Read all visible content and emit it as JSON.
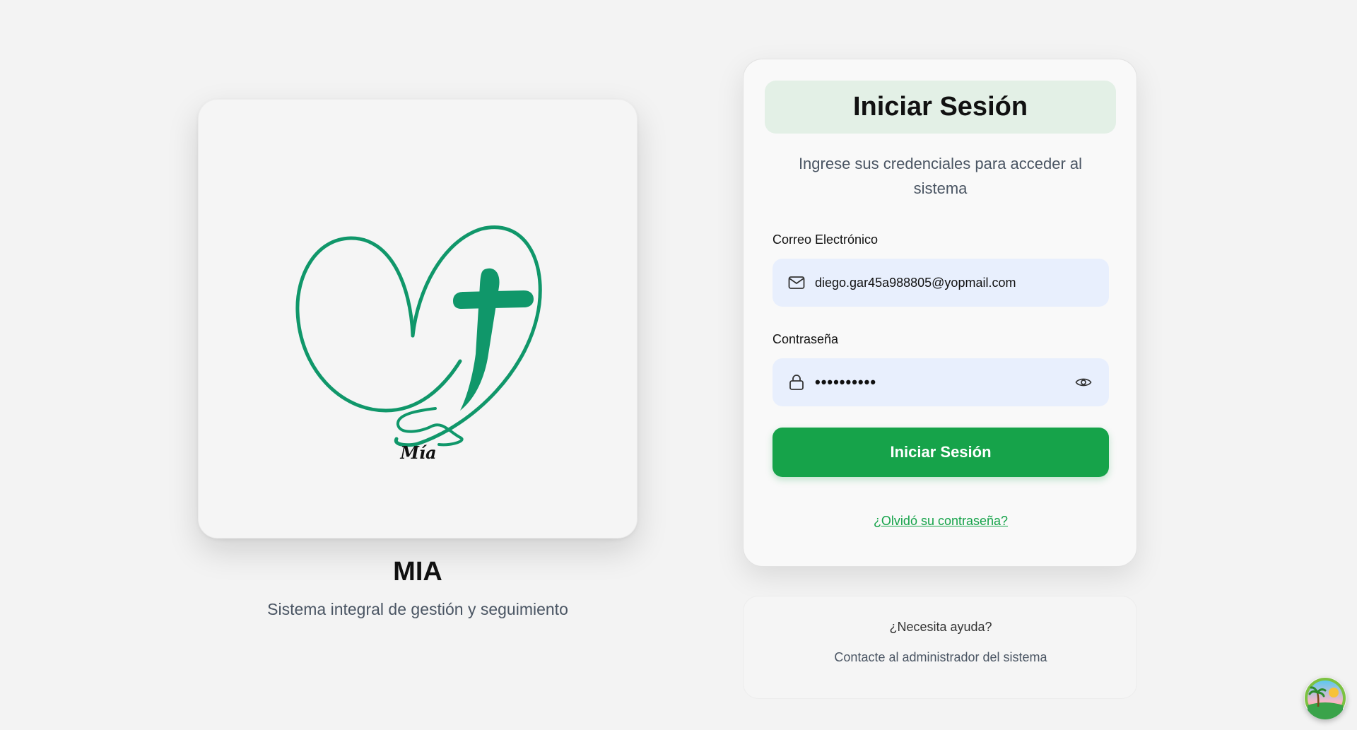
{
  "brand": {
    "logo_caption": "Mía",
    "title": "MIA",
    "subtitle": "Sistema integral de gestión y seguimiento",
    "accent_color": "#10976a"
  },
  "login": {
    "heading": "Iniciar Sesión",
    "description": "Ingrese sus credenciales para acceder al sistema",
    "email_label": "Correo Electrónico",
    "email_value": "diego.gar45a988805@yopmail.com",
    "email_icon": "mail-icon",
    "password_label": "Contraseña",
    "password_masked": "••••••••••",
    "password_icon": "lock-icon",
    "toggle_icon": "eye-icon",
    "submit_label": "Iniciar Sesión",
    "forgot_link": "¿Olvidó su contraseña?",
    "button_color": "#16a34a"
  },
  "help": {
    "title": "¿Necesita ayuda?",
    "text": "Contacte al administrador del sistema"
  },
  "floating_button": {
    "icon": "island-icon"
  }
}
